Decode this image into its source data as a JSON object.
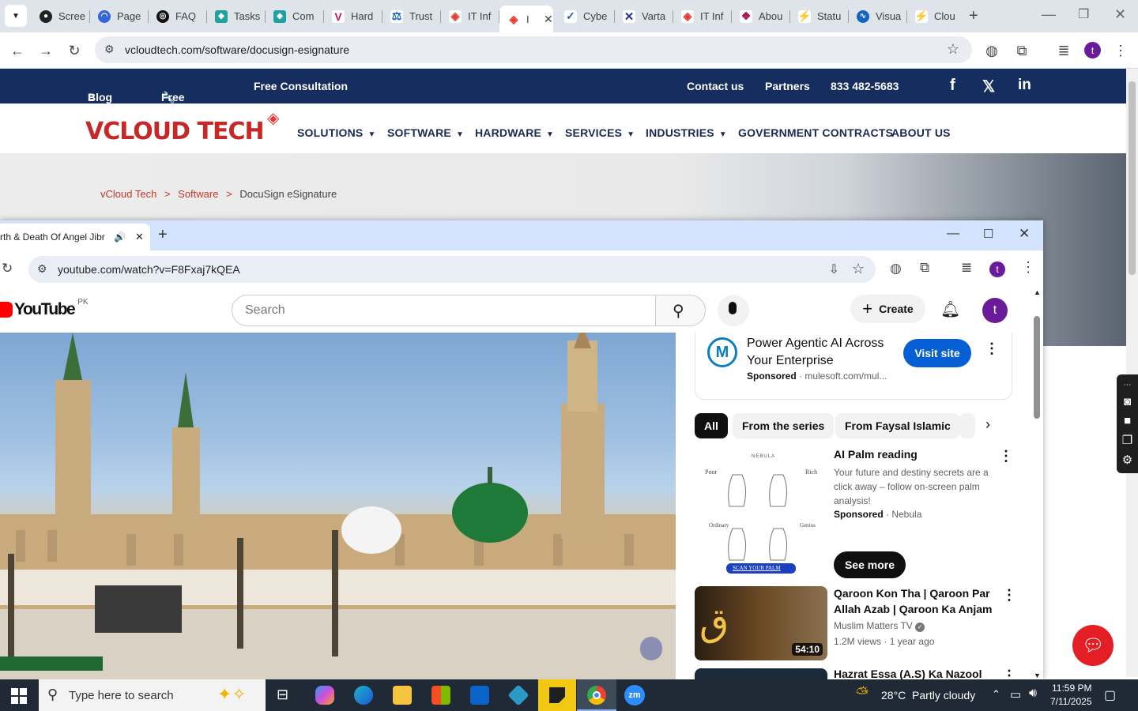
{
  "back_browser": {
    "tabs": [
      {
        "title": "Scree"
      },
      {
        "title": "Page"
      },
      {
        "title": "FAQ"
      },
      {
        "title": "Tasks"
      },
      {
        "title": "Com"
      },
      {
        "title": "Hard"
      },
      {
        "title": "Trust"
      },
      {
        "title": "IT Inf"
      },
      {
        "title": "I"
      },
      {
        "title": "Cybe"
      },
      {
        "title": "Varta"
      },
      {
        "title": "IT Inf"
      },
      {
        "title": "Abou"
      },
      {
        "title": "Statu"
      },
      {
        "title": "Visua"
      },
      {
        "title": "Clou"
      }
    ],
    "url": "vcloudtech.com/software/docusign-esignature",
    "profile_initial": "t"
  },
  "vcloud": {
    "topbar": {
      "blog": "Blog",
      "free_tools": "Free Tools",
      "free_consultation": "Free Consultation",
      "contact": "Contact us",
      "partners": "Partners",
      "phone": "833 482-5683"
    },
    "logo": "VCLOUD TECH",
    "menu": [
      "SOLUTIONS",
      "SOFTWARE",
      "HARDWARE",
      "SERVICES",
      "INDUSTRIES",
      "GOVERNMENT CONTRACTS",
      "ABOUT US"
    ],
    "breadcrumb": {
      "home": "vCloud Tech",
      "sep": ">",
      "section": "Software",
      "current": "DocuSign eSignature"
    }
  },
  "front_browser": {
    "tab_title": "rth & Death Of Angel Jibr",
    "url": "youtube.com/watch?v=F8Fxaj7kQEA",
    "profile_initial": "t"
  },
  "youtube": {
    "logo": "YouTube",
    "country": "PK",
    "search_placeholder": "Search",
    "create": "Create",
    "avatar": "t",
    "ad_top": {
      "title": "Power Agentic AI Across Your Enterprise",
      "sponsored": "Sponsored",
      "domain": "mulesoft.com/mul...",
      "cta": "Visit site"
    },
    "chips": [
      "All",
      "From the series",
      "From Faysal Islamic"
    ],
    "ad_palm": {
      "title": "AI Palm reading",
      "desc": "Your future and destiny secrets are a click away – follow on-screen palm analysis!",
      "sponsored": "Sponsored",
      "advertiser": "Nebula",
      "cta": "See more",
      "thumb_labels": {
        "brand": "NEBULA",
        "poor": "Poor",
        "rich": "Rich",
        "ordinary": "Ordinary",
        "genius": "Genius",
        "scan": "SCAN YOUR PALM"
      }
    },
    "videos": [
      {
        "title": "Qaroon Kon Tha | Qaroon Par Allah Azab | Qaroon Ka Anjam ...",
        "channel": "Muslim Matters TV",
        "views": "1.2M views",
        "age": "1 year ago",
        "duration": "54:10"
      },
      {
        "title": "Hazrat Essa (A.S) Ka Nazool"
      }
    ]
  },
  "taskbar": {
    "search_placeholder": "Type here to search",
    "weather": "28°C  Partly cloudy",
    "time": "11:59 PM",
    "date": "7/11/2025"
  }
}
